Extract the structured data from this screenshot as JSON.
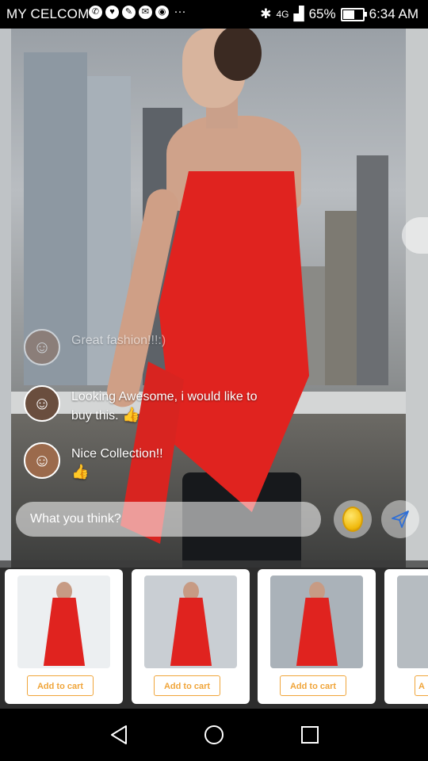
{
  "status_bar": {
    "carrier": "MY CELCOM",
    "signal_label": "4G",
    "battery_percent": "65%",
    "battery_level": 0.65,
    "time": "6:34 AM",
    "notification_icons": [
      "whatsapp-icon",
      "heart-health-icon",
      "chat-icon",
      "gmail-icon",
      "chrome-icon"
    ],
    "more": "···"
  },
  "comments": [
    {
      "text": "Great fashion!!!:)",
      "avatar_icon": "user-avatar-woman"
    },
    {
      "text": "Looking Awesome, i would like to buy this.",
      "emoji": "👍",
      "avatar_icon": "user-avatar-man"
    },
    {
      "text": "Nice Collection!!",
      "emoji": "👍",
      "avatar_icon": "user-avatar-woman"
    }
  ],
  "comment_input": {
    "placeholder": "What you think?"
  },
  "actions": {
    "coin_icon": "gold-coin-icon",
    "send_icon": "send-icon"
  },
  "products": [
    {
      "add_to_cart": "Add to cart"
    },
    {
      "add_to_cart": "Add to cart"
    },
    {
      "add_to_cart": "Add to cart"
    },
    {
      "add_to_cart": "A"
    }
  ],
  "colors": {
    "accent": "#f0a53a",
    "dress_red": "#e0231f",
    "coin_gold": "#f0b90b"
  }
}
